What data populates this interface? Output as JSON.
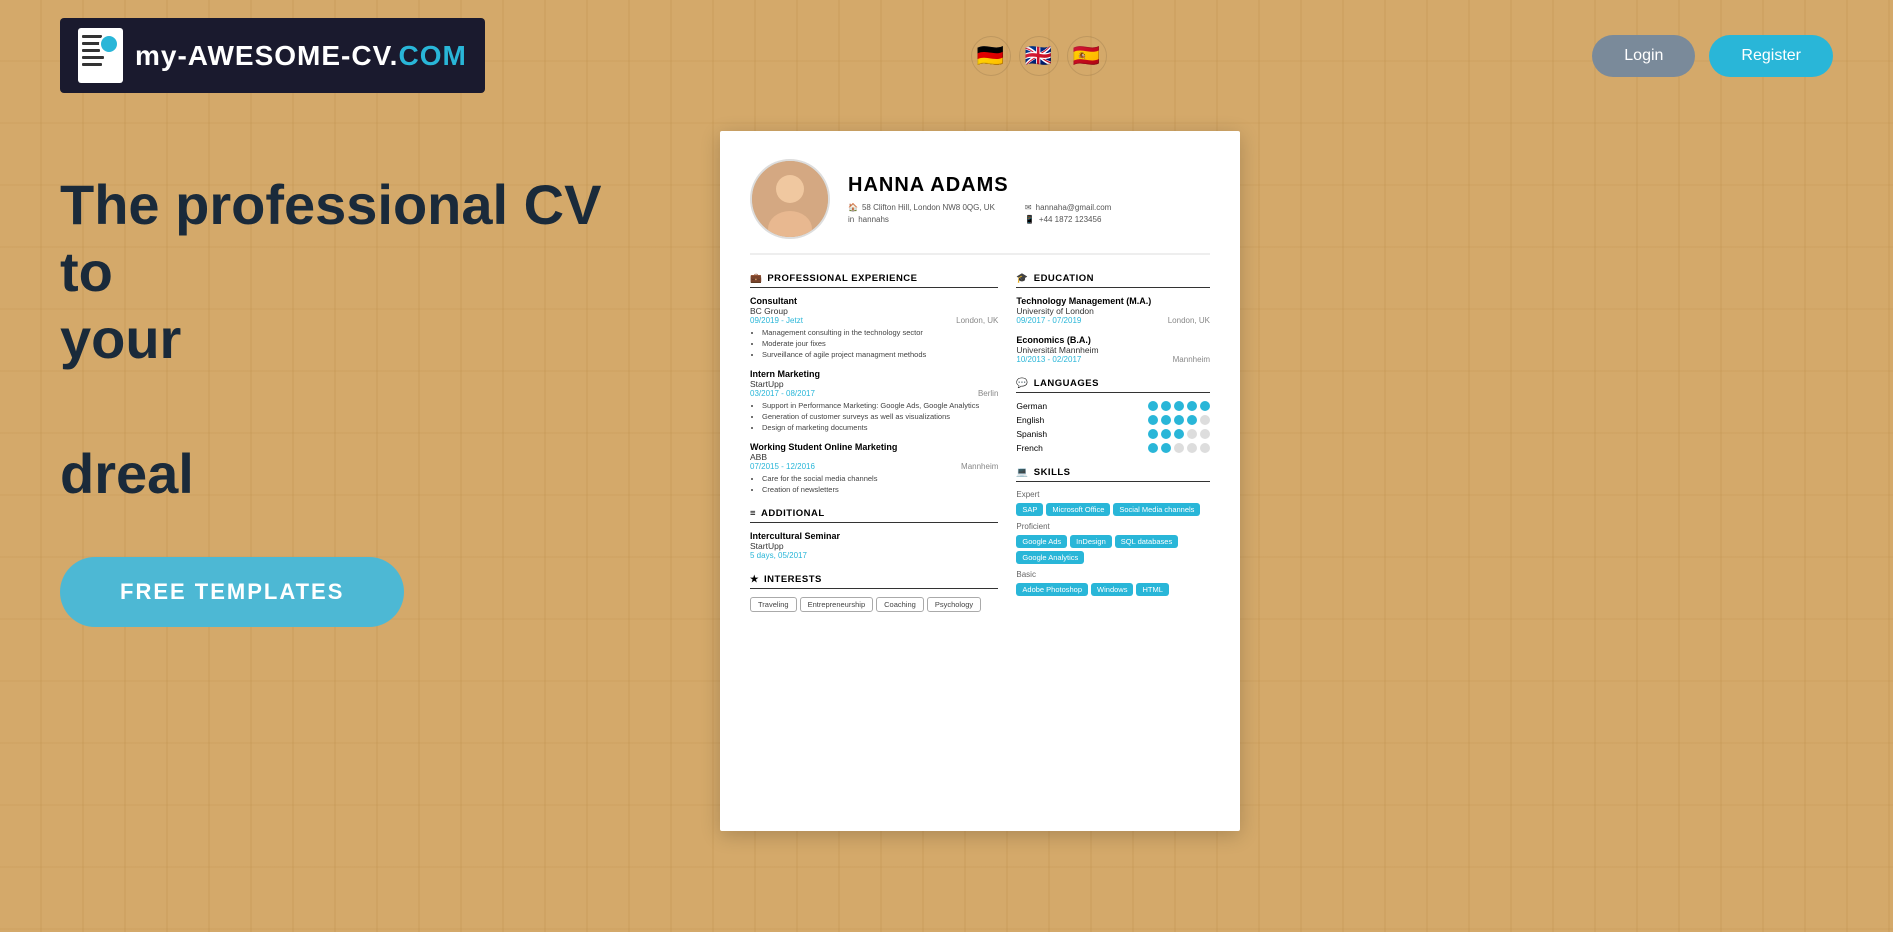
{
  "header": {
    "logo_text_part1": "my-AWESOME-CV.",
    "logo_text_part2": "COM",
    "login_label": "Login",
    "register_label": "Register"
  },
  "languages": [
    {
      "flag": "🇩🇪",
      "name": "German"
    },
    {
      "flag": "🇬🇧",
      "name": "English"
    },
    {
      "flag": "🇪🇸",
      "name": "Spanish"
    }
  ],
  "hero": {
    "title_line1": "The professional CV to",
    "title_line2": "your",
    "title_line3": "dreal",
    "cta_label": "FREE TEMPLATES"
  },
  "cv": {
    "name": "HANNA ADAMS",
    "address": "58 Clifton Hill, London NW8 0QG, UK",
    "linkedin": "hannahs",
    "email": "hannaha@gmail.com",
    "phone": "+44 1872 123456",
    "sections": {
      "experience_title": "PROFESSIONAL EXPERIENCE",
      "education_title": "EDUCATION",
      "languages_title": "LANGUAGES",
      "skills_title": "SKILLS",
      "additional_title": "ADDITIONAL",
      "interests_title": "INTERESTS"
    },
    "experience": [
      {
        "title": "Consultant",
        "company": "BC Group",
        "date": "09/2019 - Jetzt",
        "location": "London, UK",
        "bullets": [
          "Management consulting in the technology sector",
          "Moderate jour fixes",
          "Surveillance of agile project managment methods"
        ]
      },
      {
        "title": "Intern Marketing",
        "company": "StartUpp",
        "date": "03/2017 - 08/2017",
        "location": "Berlin",
        "bullets": [
          "Support in Performance Marketing: Google Ads, Google Analytics",
          "Generation of customer surveys as well as visualizations",
          "Design of marketing documents"
        ]
      },
      {
        "title": "Working Student Online Marketing",
        "company": "ABB",
        "date": "07/2015 - 12/2016",
        "location": "Mannheim",
        "bullets": [
          "Care for the social media channels",
          "Creation of newsletters"
        ]
      }
    ],
    "education": [
      {
        "degree": "Technology Management (M.A.)",
        "school": "University of London",
        "date": "09/2017 - 07/2019",
        "location": "London, UK"
      },
      {
        "degree": "Economics (B.A.)",
        "school": "Universität Mannheim",
        "date": "10/2013 - 02/2017",
        "location": "Mannheim"
      }
    ],
    "languages": [
      {
        "name": "German",
        "dots": 5
      },
      {
        "name": "English",
        "dots": 4
      },
      {
        "name": "Spanish",
        "dots": 3
      },
      {
        "name": "French",
        "dots": 2
      }
    ],
    "skills": {
      "expert": [
        "SAP",
        "Microsoft Office",
        "Social Media channels"
      ],
      "proficient": [
        "Google Ads",
        "InDesign",
        "SQL databases",
        "Google Analytics"
      ],
      "basic": [
        "Adobe Photoshop",
        "Windows",
        "HTML"
      ]
    },
    "additional": [
      {
        "title": "Intercultural Seminar",
        "org": "StartUpp",
        "date": "5 days, 05/2017"
      }
    ],
    "interests": [
      "Traveling",
      "Entrepreneurship",
      "Coaching",
      "Psychology"
    ]
  }
}
